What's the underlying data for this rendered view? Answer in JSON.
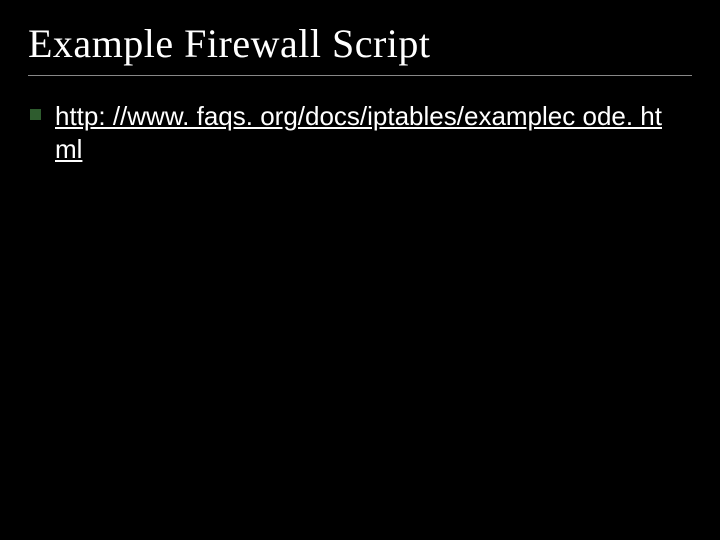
{
  "slide": {
    "title": "Example Firewall Script",
    "bullets": [
      {
        "text": "http: //www. faqs. org/docs/iptables/examplec ode. html"
      }
    ]
  }
}
